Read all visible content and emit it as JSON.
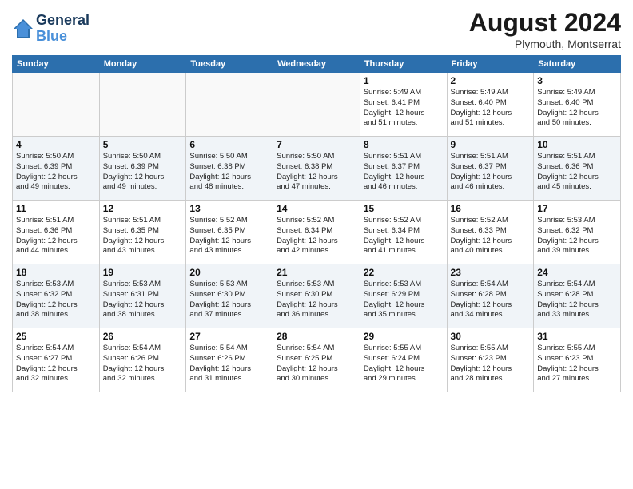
{
  "header": {
    "logo_line1": "General",
    "logo_line2": "Blue",
    "month": "August 2024",
    "location": "Plymouth, Montserrat"
  },
  "days_of_week": [
    "Sunday",
    "Monday",
    "Tuesday",
    "Wednesday",
    "Thursday",
    "Friday",
    "Saturday"
  ],
  "weeks": [
    [
      {
        "day": "",
        "info": ""
      },
      {
        "day": "",
        "info": ""
      },
      {
        "day": "",
        "info": ""
      },
      {
        "day": "",
        "info": ""
      },
      {
        "day": "1",
        "info": "Sunrise: 5:49 AM\nSunset: 6:41 PM\nDaylight: 12 hours\nand 51 minutes."
      },
      {
        "day": "2",
        "info": "Sunrise: 5:49 AM\nSunset: 6:40 PM\nDaylight: 12 hours\nand 51 minutes."
      },
      {
        "day": "3",
        "info": "Sunrise: 5:49 AM\nSunset: 6:40 PM\nDaylight: 12 hours\nand 50 minutes."
      }
    ],
    [
      {
        "day": "4",
        "info": "Sunrise: 5:50 AM\nSunset: 6:39 PM\nDaylight: 12 hours\nand 49 minutes."
      },
      {
        "day": "5",
        "info": "Sunrise: 5:50 AM\nSunset: 6:39 PM\nDaylight: 12 hours\nand 49 minutes."
      },
      {
        "day": "6",
        "info": "Sunrise: 5:50 AM\nSunset: 6:38 PM\nDaylight: 12 hours\nand 48 minutes."
      },
      {
        "day": "7",
        "info": "Sunrise: 5:50 AM\nSunset: 6:38 PM\nDaylight: 12 hours\nand 47 minutes."
      },
      {
        "day": "8",
        "info": "Sunrise: 5:51 AM\nSunset: 6:37 PM\nDaylight: 12 hours\nand 46 minutes."
      },
      {
        "day": "9",
        "info": "Sunrise: 5:51 AM\nSunset: 6:37 PM\nDaylight: 12 hours\nand 46 minutes."
      },
      {
        "day": "10",
        "info": "Sunrise: 5:51 AM\nSunset: 6:36 PM\nDaylight: 12 hours\nand 45 minutes."
      }
    ],
    [
      {
        "day": "11",
        "info": "Sunrise: 5:51 AM\nSunset: 6:36 PM\nDaylight: 12 hours\nand 44 minutes."
      },
      {
        "day": "12",
        "info": "Sunrise: 5:51 AM\nSunset: 6:35 PM\nDaylight: 12 hours\nand 43 minutes."
      },
      {
        "day": "13",
        "info": "Sunrise: 5:52 AM\nSunset: 6:35 PM\nDaylight: 12 hours\nand 43 minutes."
      },
      {
        "day": "14",
        "info": "Sunrise: 5:52 AM\nSunset: 6:34 PM\nDaylight: 12 hours\nand 42 minutes."
      },
      {
        "day": "15",
        "info": "Sunrise: 5:52 AM\nSunset: 6:34 PM\nDaylight: 12 hours\nand 41 minutes."
      },
      {
        "day": "16",
        "info": "Sunrise: 5:52 AM\nSunset: 6:33 PM\nDaylight: 12 hours\nand 40 minutes."
      },
      {
        "day": "17",
        "info": "Sunrise: 5:53 AM\nSunset: 6:32 PM\nDaylight: 12 hours\nand 39 minutes."
      }
    ],
    [
      {
        "day": "18",
        "info": "Sunrise: 5:53 AM\nSunset: 6:32 PM\nDaylight: 12 hours\nand 38 minutes."
      },
      {
        "day": "19",
        "info": "Sunrise: 5:53 AM\nSunset: 6:31 PM\nDaylight: 12 hours\nand 38 minutes."
      },
      {
        "day": "20",
        "info": "Sunrise: 5:53 AM\nSunset: 6:30 PM\nDaylight: 12 hours\nand 37 minutes."
      },
      {
        "day": "21",
        "info": "Sunrise: 5:53 AM\nSunset: 6:30 PM\nDaylight: 12 hours\nand 36 minutes."
      },
      {
        "day": "22",
        "info": "Sunrise: 5:53 AM\nSunset: 6:29 PM\nDaylight: 12 hours\nand 35 minutes."
      },
      {
        "day": "23",
        "info": "Sunrise: 5:54 AM\nSunset: 6:28 PM\nDaylight: 12 hours\nand 34 minutes."
      },
      {
        "day": "24",
        "info": "Sunrise: 5:54 AM\nSunset: 6:28 PM\nDaylight: 12 hours\nand 33 minutes."
      }
    ],
    [
      {
        "day": "25",
        "info": "Sunrise: 5:54 AM\nSunset: 6:27 PM\nDaylight: 12 hours\nand 32 minutes."
      },
      {
        "day": "26",
        "info": "Sunrise: 5:54 AM\nSunset: 6:26 PM\nDaylight: 12 hours\nand 32 minutes."
      },
      {
        "day": "27",
        "info": "Sunrise: 5:54 AM\nSunset: 6:26 PM\nDaylight: 12 hours\nand 31 minutes."
      },
      {
        "day": "28",
        "info": "Sunrise: 5:54 AM\nSunset: 6:25 PM\nDaylight: 12 hours\nand 30 minutes."
      },
      {
        "day": "29",
        "info": "Sunrise: 5:55 AM\nSunset: 6:24 PM\nDaylight: 12 hours\nand 29 minutes."
      },
      {
        "day": "30",
        "info": "Sunrise: 5:55 AM\nSunset: 6:23 PM\nDaylight: 12 hours\nand 28 minutes."
      },
      {
        "day": "31",
        "info": "Sunrise: 5:55 AM\nSunset: 6:23 PM\nDaylight: 12 hours\nand 27 minutes."
      }
    ]
  ]
}
